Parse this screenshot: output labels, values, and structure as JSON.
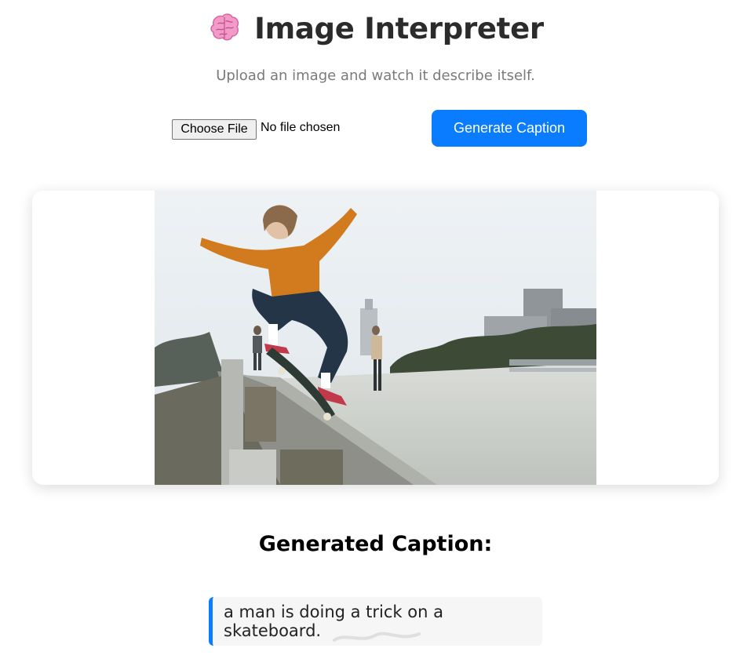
{
  "header": {
    "title": "Image Interpreter",
    "subtitle": "Upload an image and watch it describe itself."
  },
  "upload": {
    "choose_file_label": "Choose File",
    "status": "No file chosen",
    "generate_label": "Generate Caption"
  },
  "preview": {
    "image_icon": "skateboarder-photo"
  },
  "result": {
    "heading": "Generated Caption:",
    "caption": "a man is doing a trick on a skateboard."
  },
  "colors": {
    "accent": "#0a7cff",
    "caption_bg": "#f6f6f6"
  }
}
